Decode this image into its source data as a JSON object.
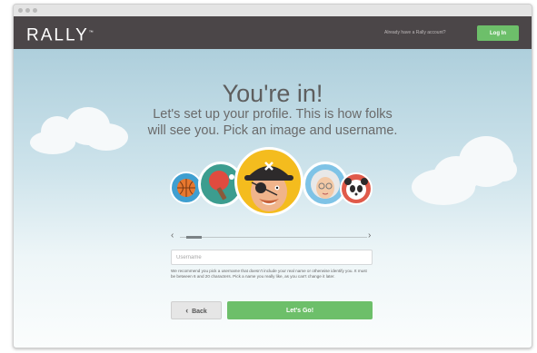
{
  "header": {
    "logo": "RALLY",
    "logo_tm": "™",
    "account_prompt": "Already have a Rally account?",
    "login_label": "Log In"
  },
  "main": {
    "title": "You're in!",
    "subtitle_line1": "Let's set up your profile. This is how folks",
    "subtitle_line2": "will see you. Pick an image and username.",
    "avatars": [
      {
        "name": "basketball-avatar",
        "color": "#3f9fd0"
      },
      {
        "name": "ping-pong-avatar",
        "color": "#3c9d8f"
      },
      {
        "name": "pirate-avatar",
        "color": "#f4bc1e",
        "selected": true
      },
      {
        "name": "grandma-avatar",
        "color": "#7fc3e6"
      },
      {
        "name": "panda-avatar",
        "color": "#e05a4a"
      }
    ],
    "carousel": {
      "prev": "‹",
      "next": "›"
    },
    "username_placeholder": "Username",
    "help_text": "We recommend you pick a username that doesn't include your real name or otherwise identify you. It must be between 6 and 20 characters. Pick a name you really like, as you can't change it later.",
    "back_label": "Back",
    "back_icon": "‹",
    "go_label": "Let's Go!"
  },
  "colors": {
    "header": "#4b4648",
    "accent_green": "#6dbf6a",
    "sky_top": "#aecfdc"
  }
}
